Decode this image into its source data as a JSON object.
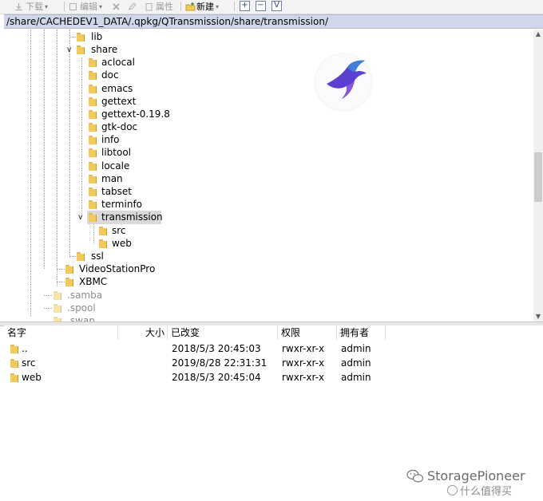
{
  "toolbar": {
    "download_label": "下载",
    "edit_label": "编辑",
    "properties_label": "属性",
    "new_label": "新建",
    "expand_box": "+",
    "collapse_box": "−",
    "filter_box": "V"
  },
  "path": "/share/CACHEDEV1_DATA/.qpkg/QTransmission/share/transmission/",
  "tree": {
    "nodes": [
      "lib",
      "share",
      "aclocal",
      "doc",
      "emacs",
      "gettext",
      "gettext-0.19.8",
      "gtk-doc",
      "info",
      "libtool",
      "locale",
      "man",
      "tabset",
      "terminfo",
      "transmission",
      "src",
      "web",
      "ssl",
      "VideoStationPro",
      "XBMC",
      ".samba",
      ".spool",
      ".swap"
    ]
  },
  "list": {
    "columns": [
      "名字",
      "大小",
      "已改变",
      "权限",
      "拥有者"
    ],
    "rows": [
      {
        "name": "..",
        "size": "",
        "modified": "2018/5/3 20:45:03",
        "perm": "rwxr-xr-x",
        "owner": "admin"
      },
      {
        "name": "src",
        "size": "",
        "modified": "2019/8/28 22:31:31",
        "perm": "rwxr-xr-x",
        "owner": "admin"
      },
      {
        "name": "web",
        "size": "",
        "modified": "2018/5/3 20:45:04",
        "perm": "rwxr-xr-x",
        "owner": "admin"
      }
    ]
  },
  "watermark": {
    "brand": "StoragePioneer",
    "site": "什么值得买"
  },
  "colors": {
    "pathbar": "#cfd7e8",
    "selection": "#d9d9d9",
    "folder": "#f2ca5a",
    "swift_logo": "#5a3fd0"
  }
}
